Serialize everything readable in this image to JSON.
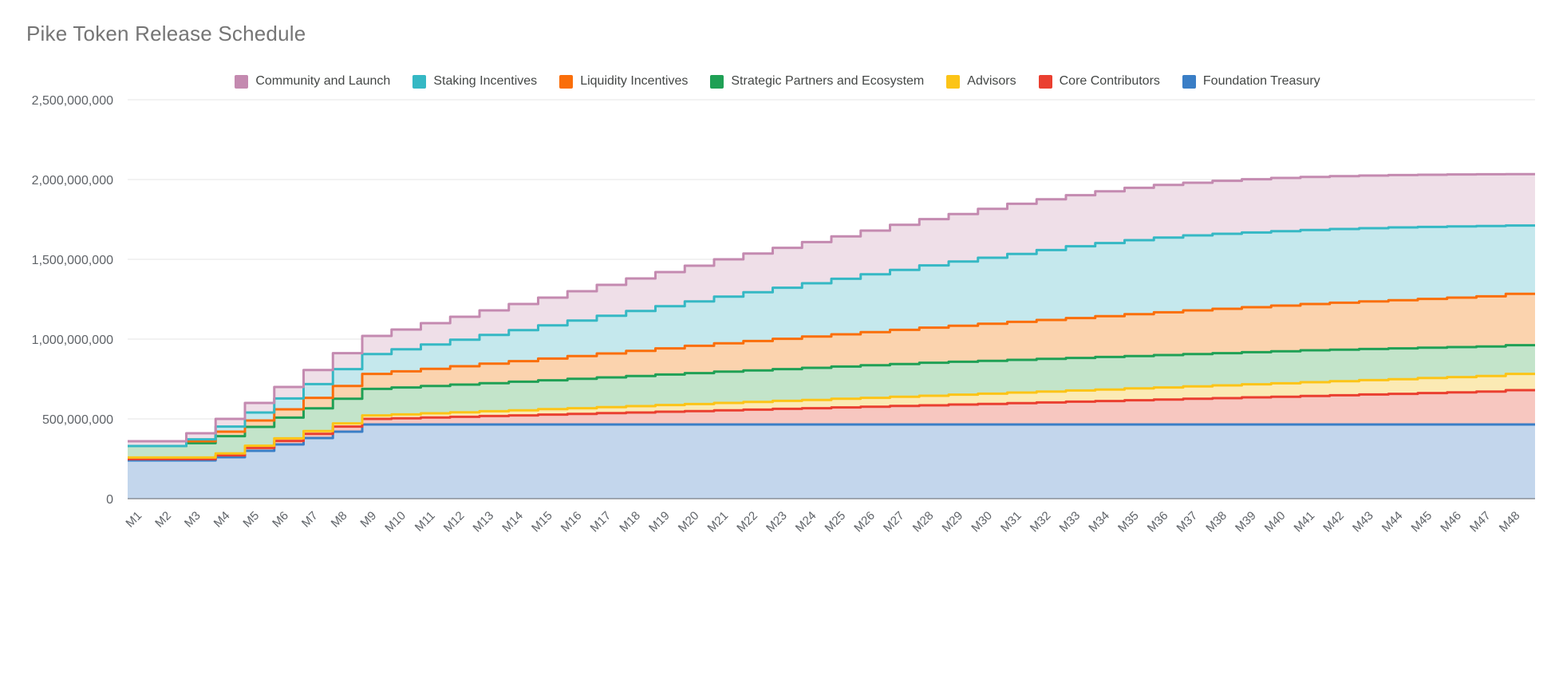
{
  "chart_title": "Pike Token Release Schedule",
  "legend": {
    "position": "top-center",
    "items": [
      {
        "label": "Community and Launch",
        "color": "#c48ab0",
        "fill": "#efdfe8"
      },
      {
        "label": "Staking Incentives",
        "color": "#35b8c4",
        "fill": "#c5e8ed"
      },
      {
        "label": "Liquidity Incentives",
        "color": "#fa6e0a",
        "fill": "#fbd3ae"
      },
      {
        "label": "Strategic Partners and Ecosystem",
        "color": "#1fa055",
        "fill": "#c3e4ca"
      },
      {
        "label": "Advisors",
        "color": "#fcc417",
        "fill": "#fbeab4"
      },
      {
        "label": "Core Contributors",
        "color": "#ea3f30",
        "fill": "#f7c7c0"
      },
      {
        "label": "Foundation Treasury",
        "color": "#3a7ec6",
        "fill": "#c3d6ec"
      }
    ]
  },
  "axes": {
    "y_ticks": [
      "0",
      "500,000,000",
      "1,000,000,000",
      "1,500,000,000",
      "2,000,000,000",
      "2,500,000,000"
    ],
    "y_tick_values": [
      0,
      500000000,
      1000000000,
      1500000000,
      2000000000,
      2500000000
    ],
    "y_min": 0,
    "y_max": 2500000000,
    "x_ticks": [
      "M1",
      "M2",
      "M3",
      "M4",
      "M5",
      "M6",
      "M7",
      "M8",
      "M9",
      "M10",
      "M11",
      "M12",
      "M13",
      "M14",
      "M15",
      "M16",
      "M17",
      "M18",
      "M19",
      "M20",
      "M21",
      "M22",
      "M23",
      "M24",
      "M25",
      "M26",
      "M27",
      "M28",
      "M29",
      "M30",
      "M31",
      "M32",
      "M33",
      "M34",
      "M35",
      "M36",
      "M37",
      "M38",
      "M39",
      "M40",
      "M41",
      "M42",
      "M43",
      "M44",
      "M45",
      "M46",
      "M47",
      "M48"
    ],
    "x_label_rotation": -45,
    "grid": "horizontal-only"
  },
  "chart_data": {
    "type": "area",
    "subtype": "stacked-step-area",
    "title": "Pike Token Release Schedule",
    "xlabel": "",
    "ylabel": "",
    "ylim": [
      0,
      2500000000
    ],
    "grid": true,
    "legend_position": "top",
    "stack_order_bottom_to_top": [
      "Foundation Treasury",
      "Core Contributors",
      "Advisors",
      "Strategic Partners and Ecosystem",
      "Liquidity Incentives",
      "Staking Incentives",
      "Community and Launch"
    ],
    "categories": [
      "M1",
      "M2",
      "M3",
      "M4",
      "M5",
      "M6",
      "M7",
      "M8",
      "M9",
      "M10",
      "M11",
      "M12",
      "M13",
      "M14",
      "M15",
      "M16",
      "M17",
      "M18",
      "M19",
      "M20",
      "M21",
      "M22",
      "M23",
      "M24",
      "M25",
      "M26",
      "M27",
      "M28",
      "M29",
      "M30",
      "M31",
      "M32",
      "M33",
      "M34",
      "M35",
      "M36",
      "M37",
      "M38",
      "M39",
      "M40",
      "M41",
      "M42",
      "M43",
      "M44",
      "M45",
      "M46",
      "M47",
      "M48"
    ],
    "series": [
      {
        "name": "Foundation Treasury",
        "color": "#3a7ec6",
        "fill": "#c3d6ec",
        "cumulative_values": [
          240000000,
          240000000,
          240000000,
          260000000,
          300000000,
          340000000,
          380000000,
          420000000,
          465000000,
          465000000,
          465000000,
          465000000,
          465000000,
          465000000,
          465000000,
          465000000,
          465000000,
          465000000,
          465000000,
          465000000,
          465000000,
          465000000,
          465000000,
          465000000,
          465000000,
          465000000,
          465000000,
          465000000,
          465000000,
          465000000,
          465000000,
          465000000,
          465000000,
          465000000,
          465000000,
          465000000,
          465000000,
          465000000,
          465000000,
          465000000,
          465000000,
          465000000,
          465000000,
          465000000,
          465000000,
          465000000,
          465000000,
          465000000
        ]
      },
      {
        "name": "Core Contributors",
        "color": "#ea3f30",
        "fill": "#f7c7c0",
        "cumulative_values": [
          248000000,
          248000000,
          248000000,
          272000000,
          318000000,
          362000000,
          406000000,
          452000000,
          500000000,
          504000000,
          509000000,
          513000000,
          518000000,
          522000000,
          527000000,
          531000000,
          536000000,
          540000000,
          545000000,
          549000000,
          554000000,
          558000000,
          563000000,
          567000000,
          572000000,
          576000000,
          581000000,
          585000000,
          590000000,
          594000000,
          599000000,
          603000000,
          608000000,
          612000000,
          617000000,
          621000000,
          626000000,
          630000000,
          635000000,
          639000000,
          644000000,
          648000000,
          653000000,
          657000000,
          662000000,
          666000000,
          671000000,
          680000000
        ]
      },
      {
        "name": "Advisors",
        "color": "#fcc417",
        "fill": "#fbeab4",
        "cumulative_values": [
          258000000,
          258000000,
          258000000,
          284000000,
          332000000,
          378000000,
          424000000,
          472000000,
          522000000,
          528000000,
          535000000,
          541000000,
          548000000,
          554000000,
          561000000,
          567000000,
          574000000,
          580000000,
          587000000,
          593000000,
          600000000,
          606000000,
          613000000,
          619000000,
          626000000,
          632000000,
          639000000,
          645000000,
          652000000,
          658000000,
          665000000,
          671000000,
          678000000,
          684000000,
          691000000,
          697000000,
          704000000,
          710000000,
          717000000,
          723000000,
          730000000,
          736000000,
          743000000,
          749000000,
          756000000,
          762000000,
          769000000,
          782000000
        ]
      },
      {
        "name": "Strategic Partners and Ecosystem",
        "color": "#1fa055",
        "fill": "#c3e4ca",
        "cumulative_values": [
          330000000,
          330000000,
          348000000,
          392000000,
          450000000,
          508000000,
          566000000,
          626000000,
          688000000,
          697000000,
          706000000,
          715000000,
          724000000,
          733000000,
          742000000,
          751000000,
          760000000,
          769000000,
          778000000,
          787000000,
          796000000,
          804000000,
          812000000,
          820000000,
          828000000,
          836000000,
          844000000,
          852000000,
          858000000,
          864000000,
          870000000,
          876000000,
          882000000,
          888000000,
          894000000,
          900000000,
          906000000,
          912000000,
          918000000,
          924000000,
          930000000,
          934000000,
          938000000,
          942000000,
          946000000,
          950000000,
          954000000,
          962000000
        ]
      },
      {
        "name": "Liquidity Incentives",
        "color": "#fa6e0a",
        "fill": "#fbd3ae",
        "cumulative_values": [
          330000000,
          330000000,
          360000000,
          420000000,
          490000000,
          560000000,
          632000000,
          706000000,
          782000000,
          798000000,
          814000000,
          830000000,
          846000000,
          862000000,
          878000000,
          894000000,
          910000000,
          926000000,
          942000000,
          958000000,
          974000000,
          988000000,
          1002000000,
          1016000000,
          1030000000,
          1044000000,
          1058000000,
          1072000000,
          1084000000,
          1096000000,
          1108000000,
          1120000000,
          1132000000,
          1144000000,
          1156000000,
          1168000000,
          1180000000,
          1190000000,
          1200000000,
          1210000000,
          1220000000,
          1228000000,
          1236000000,
          1244000000,
          1252000000,
          1260000000,
          1268000000,
          1284000000
        ]
      },
      {
        "name": "Staking Incentives",
        "color": "#35b8c4",
        "fill": "#c5e8ed",
        "cumulative_values": [
          330000000,
          330000000,
          372000000,
          452000000,
          540000000,
          628000000,
          718000000,
          812000000,
          906000000,
          936000000,
          966000000,
          996000000,
          1026000000,
          1056000000,
          1086000000,
          1116000000,
          1146000000,
          1176000000,
          1206000000,
          1236000000,
          1266000000,
          1294000000,
          1322000000,
          1350000000,
          1378000000,
          1406000000,
          1434000000,
          1462000000,
          1486000000,
          1510000000,
          1534000000,
          1558000000,
          1582000000,
          1602000000,
          1620000000,
          1636000000,
          1650000000,
          1660000000,
          1668000000,
          1676000000,
          1684000000,
          1690000000,
          1695000000,
          1700000000,
          1703000000,
          1706000000,
          1709000000,
          1712000000
        ]
      },
      {
        "name": "Community and Launch",
        "color": "#c48ab0",
        "fill": "#efdfe8",
        "cumulative_values": [
          360000000,
          360000000,
          410000000,
          500000000,
          600000000,
          700000000,
          806000000,
          912000000,
          1020000000,
          1060000000,
          1100000000,
          1140000000,
          1180000000,
          1220000000,
          1260000000,
          1300000000,
          1340000000,
          1380000000,
          1420000000,
          1460000000,
          1500000000,
          1536000000,
          1572000000,
          1608000000,
          1644000000,
          1680000000,
          1716000000,
          1752000000,
          1784000000,
          1816000000,
          1848000000,
          1876000000,
          1902000000,
          1926000000,
          1948000000,
          1966000000,
          1980000000,
          1992000000,
          2002000000,
          2010000000,
          2016000000,
          2021000000,
          2025000000,
          2028000000,
          2030000000,
          2032000000,
          2033000000,
          2034000000
        ]
      }
    ]
  }
}
